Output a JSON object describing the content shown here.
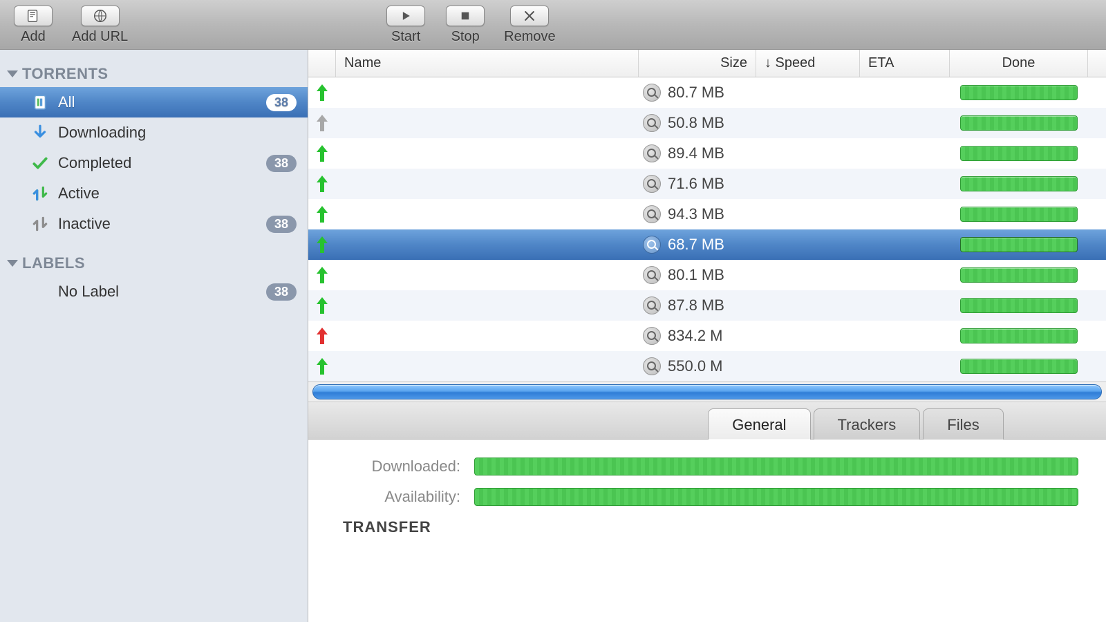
{
  "toolbar": {
    "add": "Add",
    "add_url": "Add URL",
    "start": "Start",
    "stop": "Stop",
    "remove": "Remove"
  },
  "sidebar": {
    "sections": {
      "torrents": {
        "title": "TORRENTS",
        "items": [
          {
            "label": "All",
            "badge": "38",
            "selected": true
          },
          {
            "label": "Downloading",
            "badge": ""
          },
          {
            "label": "Completed",
            "badge": "38"
          },
          {
            "label": "Active",
            "badge": ""
          },
          {
            "label": "Inactive",
            "badge": "38"
          }
        ]
      },
      "labels": {
        "title": "LABELS",
        "items": [
          {
            "label": "No Label",
            "badge": "38"
          }
        ]
      }
    }
  },
  "table": {
    "columns": {
      "name": "Name",
      "size": "Size",
      "speed": "↓ Speed",
      "eta": "ETA",
      "done": "Done"
    },
    "rows": [
      {
        "arrow": "up-green",
        "size": "80.7 MB",
        "selected": false
      },
      {
        "arrow": "up-gray",
        "size": "50.8 MB",
        "selected": false
      },
      {
        "arrow": "up-green",
        "size": "89.4 MB",
        "selected": false
      },
      {
        "arrow": "up-green",
        "size": "71.6 MB",
        "selected": false
      },
      {
        "arrow": "up-green",
        "size": "94.3 MB",
        "selected": false
      },
      {
        "arrow": "up-green",
        "size": "68.7 MB",
        "selected": true
      },
      {
        "arrow": "up-green",
        "size": "80.1 MB",
        "selected": false
      },
      {
        "arrow": "up-green",
        "size": "87.8 MB",
        "selected": false
      },
      {
        "arrow": "up-red",
        "size": "834.2 M",
        "selected": false
      },
      {
        "arrow": "up-green",
        "size": "550.0 M",
        "selected": false
      }
    ]
  },
  "detail": {
    "tabs": [
      "General",
      "Trackers",
      "Files"
    ],
    "active_tab": 0,
    "downloaded_label": "Downloaded:",
    "availability_label": "Availability:",
    "transfer_section": "TRANSFER"
  },
  "colors": {
    "green": "#27c22f",
    "gray": "#a8a8a8",
    "red": "#e23030"
  }
}
